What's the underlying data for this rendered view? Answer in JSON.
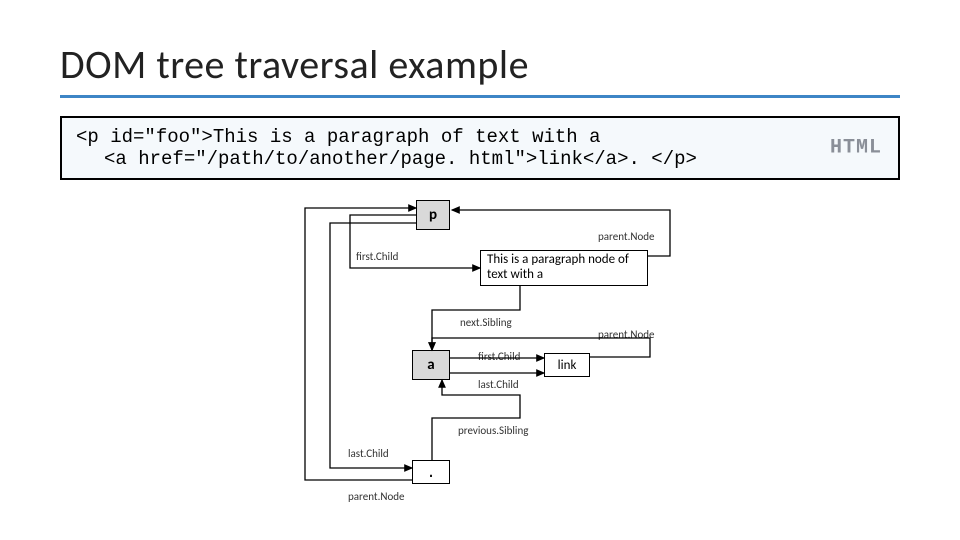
{
  "title": "DOM tree traversal example",
  "code": {
    "line1": "<p id=\"foo\">This is a paragraph of text with a",
    "line2": "<a href=\"/path/to/another/page. html\">link</a>. </p>",
    "badge": "HTML"
  },
  "diag": {
    "p": "p",
    "a": "a",
    "dot": ".",
    "text1": "This is a paragraph node of text with a",
    "link": "link",
    "firstChild": "first.Child",
    "lastChild": "last.Child",
    "parentNode": "parent.Node",
    "nextSibling": "next.Sibling",
    "previousSibling": "previous.Sibling"
  }
}
